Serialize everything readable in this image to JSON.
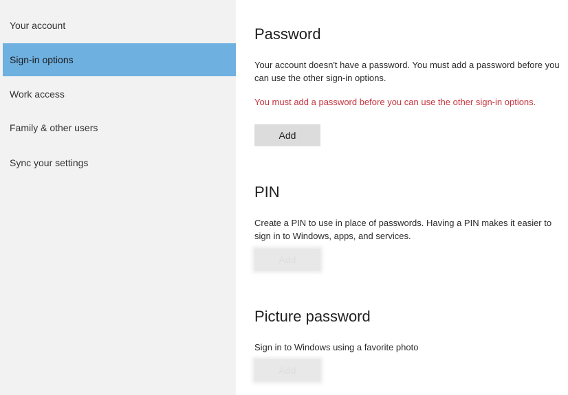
{
  "sidebar": {
    "items": [
      {
        "label": "Your account",
        "selected": false
      },
      {
        "label": "Sign-in options",
        "selected": true
      },
      {
        "label": "Work access",
        "selected": false
      },
      {
        "label": "Family & other users",
        "selected": false
      },
      {
        "label": "Sync your settings",
        "selected": false
      }
    ]
  },
  "password": {
    "title": "Password",
    "description": "Your account doesn't have a password. You must add a password before you can use the other sign-in options.",
    "error": "You must add a password before you can use the other sign-in options.",
    "button_label": "Add"
  },
  "pin": {
    "title": "PIN",
    "description": "Create a PIN to use in place of passwords. Having a PIN makes it easier to sign in to Windows, apps, and services.",
    "button_label": "Add",
    "button_enabled": false
  },
  "picture_password": {
    "title": "Picture password",
    "description": "Sign in to Windows using a favorite photo",
    "button_label": "Add",
    "button_enabled": false
  },
  "colors": {
    "selected_item": "#6eb0e0",
    "sidebar_bg": "#f2f2f2",
    "error_text": "#c4343f",
    "button_bg": "#dcdcdc"
  }
}
